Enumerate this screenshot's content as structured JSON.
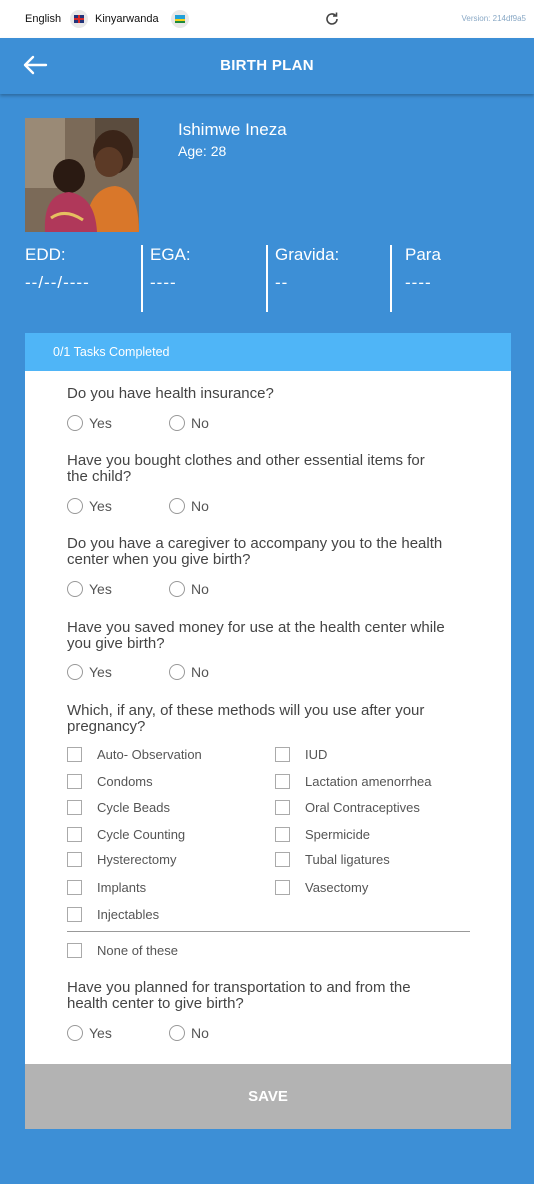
{
  "topbar": {
    "lang_en": "English",
    "lang_rw": "Kinyarwanda",
    "version": "Version: 214df9a5"
  },
  "header": {
    "title": "BIRTH PLAN"
  },
  "patient": {
    "name": "Ishimwe Ineza",
    "age": "Age: 28"
  },
  "stats": [
    {
      "label": "EDD:",
      "value": "--/--/----"
    },
    {
      "label": "EGA:",
      "value": "----"
    },
    {
      "label": "Gravida:",
      "value": "--"
    },
    {
      "label": "Para",
      "value": "----"
    }
  ],
  "card": {
    "progress": "0/1 Tasks Completed",
    "yes": "Yes",
    "no": "No",
    "q1": "Do you have health insurance?",
    "q2": "Have you bought clothes and other essential items for the child?",
    "q3": "Do you have a caregiver to accompany you to the health center when you give birth?",
    "q4": "Have you saved money for use at the health center while you give birth?",
    "q5": "Which, if any, of these methods will you use after your pregnancy?",
    "q6": "Have you planned for transportation to and from the health center to give birth?",
    "methods_left": [
      "Auto- Observation",
      "Condoms",
      "Cycle Beads",
      "Cycle Counting",
      "Hysterectomy",
      "Implants",
      "Injectables"
    ],
    "methods_right": [
      "IUD",
      "Lactation amenorrhea",
      "Oral Contraceptives",
      "Spermicide",
      "Tubal ligatures",
      "Vasectomy"
    ],
    "none": "None of these",
    "save": "SAVE"
  },
  "icons": {
    "back": "arrow-left-icon",
    "refresh": "refresh-icon"
  },
  "colors": {
    "primary": "#3d8fd6",
    "progress_bar": "#4fb5f7",
    "save_disabled": "#b3b3b3"
  }
}
